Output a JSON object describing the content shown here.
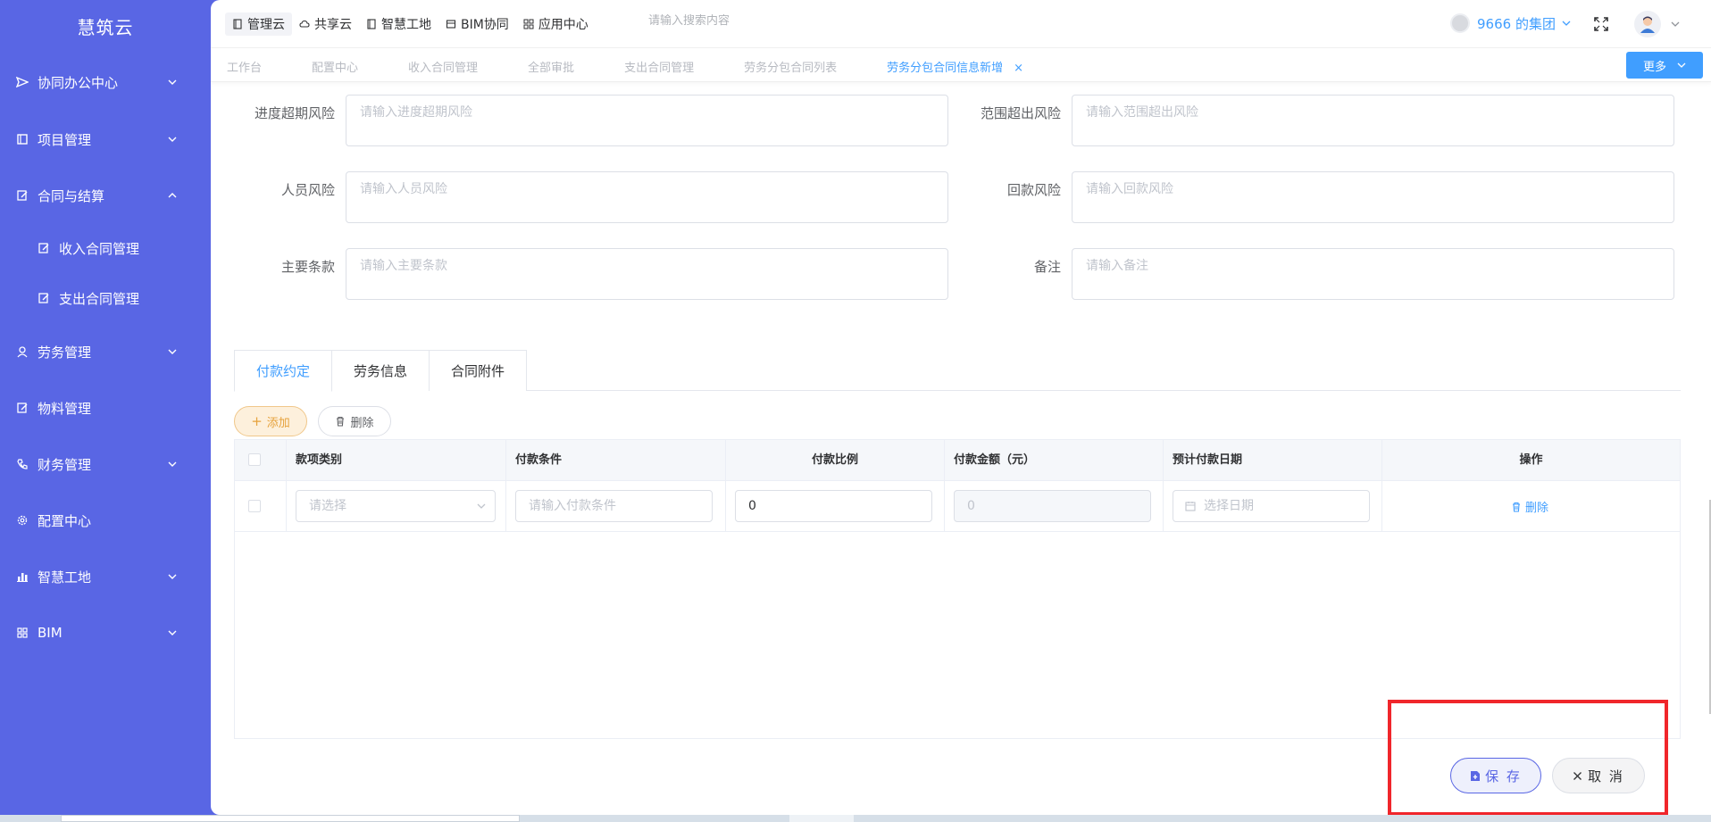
{
  "app": {
    "title": "慧筑云"
  },
  "sidebar": {
    "items": [
      {
        "label": "协同办公中心",
        "icon": "send-icon",
        "expandable": true
      },
      {
        "label": "项目管理",
        "icon": "book-icon",
        "expandable": true
      },
      {
        "label": "合同与结算",
        "icon": "edit-icon",
        "expandable": true,
        "expanded": true
      },
      {
        "label": "收入合同管理",
        "icon": "edit-icon",
        "sub": true
      },
      {
        "label": "支出合同管理",
        "icon": "edit-icon",
        "sub": true
      },
      {
        "label": "劳务管理",
        "icon": "worker-icon",
        "expandable": true
      },
      {
        "label": "物料管理",
        "icon": "edit-icon",
        "expandable": false
      },
      {
        "label": "财务管理",
        "icon": "phone-icon",
        "expandable": true
      },
      {
        "label": "配置中心",
        "icon": "gear-icon",
        "expandable": false
      },
      {
        "label": "智慧工地",
        "icon": "bar-chart-icon",
        "expandable": true
      },
      {
        "label": "BIM",
        "icon": "grid-icon",
        "expandable": true
      }
    ]
  },
  "topbar": {
    "nav": [
      {
        "label": "管理云",
        "icon": "book-icon",
        "active": true
      },
      {
        "label": "共享云",
        "icon": "cloud-icon"
      },
      {
        "label": "智慧工地",
        "icon": "book-icon"
      },
      {
        "label": "BIM协同",
        "icon": "box-icon"
      },
      {
        "label": "应用中心",
        "icon": "grid-icon"
      }
    ],
    "search_placeholder": "请输入搜索内容",
    "org_name": "9666 的集团"
  },
  "tagbar": {
    "tags": [
      {
        "label": "工作台"
      },
      {
        "label": "配置中心"
      },
      {
        "label": "收入合同管理"
      },
      {
        "label": "全部审批"
      },
      {
        "label": "支出合同管理"
      },
      {
        "label": "劳务分包合同列表"
      },
      {
        "label": "劳务分包合同信息新增",
        "active": true
      }
    ],
    "close_glyph": "×",
    "more_label": "更多"
  },
  "form": {
    "rows": [
      {
        "left": {
          "label": "进度超期风险",
          "placeholder": "请输入进度超期风险"
        },
        "right": {
          "label": "范围超出风险",
          "placeholder": "请输入范围超出风险"
        }
      },
      {
        "left": {
          "label": "人员风险",
          "placeholder": "请输入人员风险"
        },
        "right": {
          "label": "回款风险",
          "placeholder": "请输入回款风险"
        }
      },
      {
        "left": {
          "label": "主要条款",
          "placeholder": "请输入主要条款"
        },
        "right": {
          "label": "备注",
          "placeholder": "请输入备注"
        }
      }
    ]
  },
  "tabs": [
    {
      "label": "付款约定",
      "active": true
    },
    {
      "label": "劳务信息"
    },
    {
      "label": "合同附件"
    }
  ],
  "actions": {
    "add_label": "添加",
    "delete_label": "删除"
  },
  "table": {
    "headers": [
      "款项类别",
      "付款条件",
      "付款比例",
      "付款金额（元）",
      "预计付款日期",
      "操作"
    ],
    "row": {
      "category_placeholder": "请选择",
      "condition_placeholder": "请输入付款条件",
      "ratio_value": "0",
      "amount_value": "0",
      "date_placeholder": "选择日期",
      "delete_label": "删除"
    }
  },
  "footer": {
    "save_label": "保 存",
    "cancel_label": "取 消"
  },
  "colors": {
    "sidebar": "#5966e4",
    "primary": "#409eff",
    "warning": "#e6a23c",
    "highlight": "#f0262b"
  }
}
